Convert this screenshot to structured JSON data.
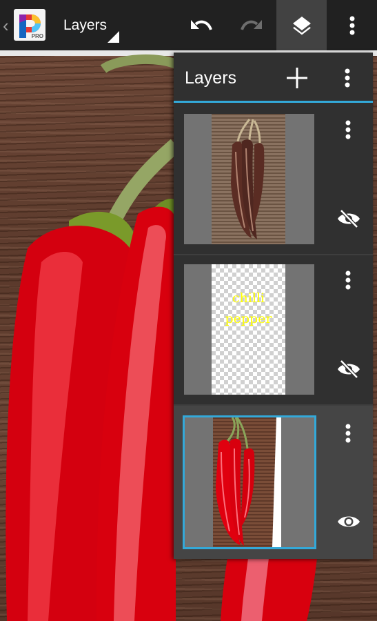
{
  "app": {
    "logo_badge": "PRO",
    "current_mode": "Layers",
    "accent_color": "#33a9d9"
  },
  "actionbar": {
    "buttons": [
      {
        "name": "undo",
        "icon": "undo-icon",
        "enabled": true
      },
      {
        "name": "redo",
        "icon": "redo-icon",
        "enabled": false
      },
      {
        "name": "layers",
        "icon": "layers-icon",
        "active": true
      },
      {
        "name": "overflow",
        "icon": "more-vert-icon"
      }
    ]
  },
  "layers_panel": {
    "title": "Layers",
    "add_icon": "plus-icon",
    "menu_icon": "more-vert-icon",
    "layers": [
      {
        "index": 0,
        "type": "image",
        "description": "sepia chilli peppers",
        "visible": false,
        "selected": false,
        "visibility_icon": "eye-off-icon"
      },
      {
        "index": 1,
        "type": "text",
        "text_lines": [
          "chilli",
          "pepper"
        ],
        "text_color": "#ffff00",
        "visible": false,
        "selected": false,
        "visibility_icon": "eye-off-icon"
      },
      {
        "index": 2,
        "type": "image",
        "description": "red chilli peppers",
        "visible": true,
        "selected": true,
        "visibility_icon": "eye-icon"
      }
    ]
  }
}
